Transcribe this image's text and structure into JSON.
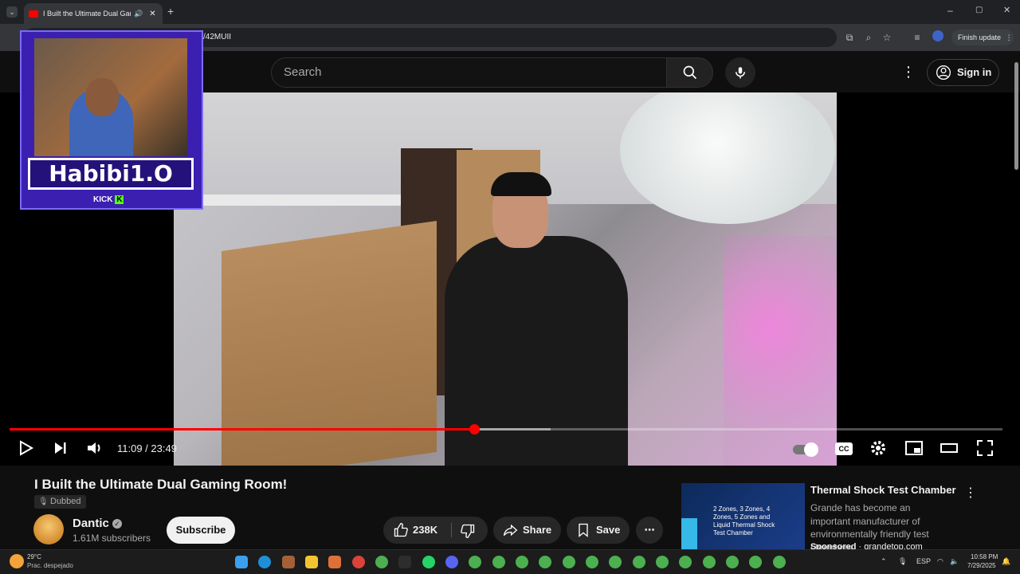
{
  "browser": {
    "tab_title": "I Built the Ultimate Dual Gami",
    "url_visible": "/42MUII",
    "finish_update": "Finish update"
  },
  "header": {
    "search_placeholder": "Search",
    "sign_in": "Sign in"
  },
  "player": {
    "time": "11:09 / 23:49",
    "progress_fraction": 0.468,
    "buffer_fraction": 0.545
  },
  "webcam": {
    "name": "Habibi1.O",
    "platform": "KICK"
  },
  "video": {
    "title": "I Built the Ultimate Dual Gaming Room!",
    "badge": "Dubbed",
    "channel": "Dantic",
    "subscribers": "1.61M subscribers",
    "subscribe": "Subscribe",
    "likes": "238K",
    "share": "Share",
    "save": "Save"
  },
  "ad": {
    "title": "Thermal Shock Test Chamber",
    "description": "Grande has become an important manufacturer of environmentally friendly test chambers",
    "sponsored": "Sponsored",
    "domain": "grandetop.com",
    "thumb_text": "2 Zones, 3 Zones, 4 Zones, 5 Zones and Liquid Thermal Shock Test Chamber"
  },
  "taskbar": {
    "weather_temp": "29°C",
    "weather_desc": "Prac. despejado",
    "lang": "ESP",
    "time": "10:58 PM",
    "date": "7/29/2025"
  },
  "colors": {
    "accent_red": "#ff0000",
    "background": "#0f0f0f",
    "webcam_purple": "#3b1fb0"
  }
}
